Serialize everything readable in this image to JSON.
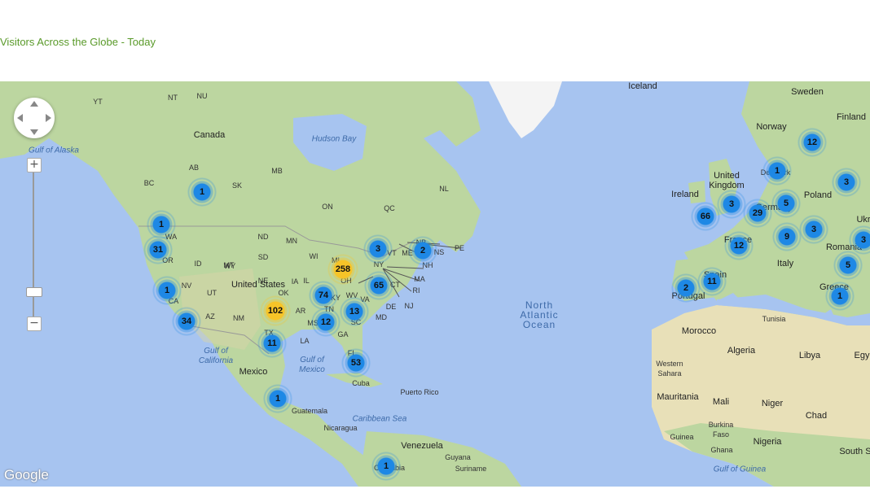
{
  "title": "Visitors Across the Globe - Today",
  "google_logo": "Google",
  "zoom": {
    "plus": "+",
    "minus": "−"
  },
  "colors": {
    "water": "#a7c4f0",
    "land": "#bcd6a0",
    "desert": "#e8e0b8",
    "ice": "#f4f4f4",
    "cluster_blue": "#1e88e5",
    "cluster_yellow": "#f6c428",
    "title": "#5a9a2a"
  },
  "labels": [
    {
      "text": "Iceland",
      "cls": "md"
    },
    {
      "text": "Sweden",
      "cls": "md"
    },
    {
      "text": "Finland",
      "cls": "md"
    },
    {
      "text": "Norway",
      "cls": "md"
    },
    {
      "text": "Canada",
      "cls": "md"
    },
    {
      "text": "Hudson Bay",
      "cls": "water"
    },
    {
      "text": "Gulf of Alaska",
      "cls": "water"
    },
    {
      "text": "YT",
      "cls": "sm"
    },
    {
      "text": "NT",
      "cls": "sm"
    },
    {
      "text": "NU",
      "cls": "sm"
    },
    {
      "text": "BC",
      "cls": "sm"
    },
    {
      "text": "AB",
      "cls": "sm"
    },
    {
      "text": "SK",
      "cls": "sm"
    },
    {
      "text": "MB",
      "cls": "sm"
    },
    {
      "text": "ON",
      "cls": "sm"
    },
    {
      "text": "QC",
      "cls": "sm"
    },
    {
      "text": "NL",
      "cls": "sm"
    },
    {
      "text": "WA",
      "cls": "sm"
    },
    {
      "text": "OR",
      "cls": "sm"
    },
    {
      "text": "ID",
      "cls": "sm"
    },
    {
      "text": "MT",
      "cls": "sm"
    },
    {
      "text": "ND",
      "cls": "sm"
    },
    {
      "text": "MN",
      "cls": "sm"
    },
    {
      "text": "WY",
      "cls": "sm"
    },
    {
      "text": "SD",
      "cls": "sm"
    },
    {
      "text": "NE",
      "cls": "sm"
    },
    {
      "text": "WI",
      "cls": "sm"
    },
    {
      "text": "IA",
      "cls": "sm"
    },
    {
      "text": "NV",
      "cls": "sm"
    },
    {
      "text": "UT",
      "cls": "sm"
    },
    {
      "text": "CA",
      "cls": "sm"
    },
    {
      "text": "AZ",
      "cls": "sm"
    },
    {
      "text": "NM",
      "cls": "sm"
    },
    {
      "text": "TX",
      "cls": "sm"
    },
    {
      "text": "OK",
      "cls": "sm"
    },
    {
      "text": "AR",
      "cls": "sm"
    },
    {
      "text": "MS",
      "cls": "sm"
    },
    {
      "text": "LA",
      "cls": "sm"
    },
    {
      "text": "TN",
      "cls": "sm"
    },
    {
      "text": "KY",
      "cls": "sm"
    },
    {
      "text": "WV",
      "cls": "sm"
    },
    {
      "text": "IL",
      "cls": "sm"
    },
    {
      "text": "MI",
      "cls": "sm"
    },
    {
      "text": "OH",
      "cls": "sm"
    },
    {
      "text": "GA",
      "cls": "sm"
    },
    {
      "text": "SC",
      "cls": "sm"
    },
    {
      "text": "FL",
      "cls": "sm"
    },
    {
      "text": "VA",
      "cls": "sm"
    },
    {
      "text": "NY",
      "cls": "sm"
    },
    {
      "text": "VT",
      "cls": "sm"
    },
    {
      "text": "ME",
      "cls": "sm"
    },
    {
      "text": "NB",
      "cls": "sm"
    },
    {
      "text": "NS",
      "cls": "sm"
    },
    {
      "text": "PE",
      "cls": "sm"
    },
    {
      "text": "NH",
      "cls": "sm"
    },
    {
      "text": "MA",
      "cls": "sm"
    },
    {
      "text": "CT",
      "cls": "sm"
    },
    {
      "text": "RI",
      "cls": "sm"
    },
    {
      "text": "NJ",
      "cls": "sm"
    },
    {
      "text": "DE",
      "cls": "sm"
    },
    {
      "text": "MD",
      "cls": "sm"
    },
    {
      "text": "United States",
      "cls": "lg"
    },
    {
      "text": "Mexico",
      "cls": "lg"
    },
    {
      "text": "Gulf of\nCalifornia",
      "cls": "water"
    },
    {
      "text": "Gulf of\nMexico",
      "cls": "water"
    },
    {
      "text": "Cuba",
      "cls": "sm"
    },
    {
      "text": "Puerto Rico",
      "cls": "sm"
    },
    {
      "text": "Guatemala",
      "cls": "sm"
    },
    {
      "text": "Nicaragua",
      "cls": "sm"
    },
    {
      "text": "Caribbean Sea",
      "cls": "water"
    },
    {
      "text": "Venezuela",
      "cls": "md"
    },
    {
      "text": "Guyana",
      "cls": "sm"
    },
    {
      "text": "Suriname",
      "cls": "sm"
    },
    {
      "text": "Colombia",
      "cls": "sm"
    },
    {
      "text": "North\nAtlantic\nOcean",
      "cls": "ocean"
    },
    {
      "text": "Ireland",
      "cls": "md"
    },
    {
      "text": "United\nKingdom",
      "cls": "md"
    },
    {
      "text": "Denmark",
      "cls": "sm"
    },
    {
      "text": "Germany",
      "cls": "md"
    },
    {
      "text": "Poland",
      "cls": "md"
    },
    {
      "text": "France",
      "cls": "md"
    },
    {
      "text": "Italy",
      "cls": "md"
    },
    {
      "text": "Romania",
      "cls": "md"
    },
    {
      "text": "Greece",
      "cls": "md"
    },
    {
      "text": "Spain",
      "cls": "md"
    },
    {
      "text": "Portugal",
      "cls": "md"
    },
    {
      "text": "Ukr",
      "cls": "md"
    },
    {
      "text": "Tunisia",
      "cls": "sm"
    },
    {
      "text": "Morocco",
      "cls": "md"
    },
    {
      "text": "Algeria",
      "cls": "md"
    },
    {
      "text": "Libya",
      "cls": "md"
    },
    {
      "text": "Egy",
      "cls": "md"
    },
    {
      "text": "Western\nSahara",
      "cls": "sm"
    },
    {
      "text": "Mauritania",
      "cls": "md"
    },
    {
      "text": "Mali",
      "cls": "md"
    },
    {
      "text": "Niger",
      "cls": "md"
    },
    {
      "text": "Chad",
      "cls": "md"
    },
    {
      "text": "Burkina\nFaso",
      "cls": "sm"
    },
    {
      "text": "Nigeria",
      "cls": "md"
    },
    {
      "text": "Guinea",
      "cls": "sm"
    },
    {
      "text": "Ghana",
      "cls": "sm"
    },
    {
      "text": "Gulf of Guinea",
      "cls": "water"
    },
    {
      "text": "South S",
      "cls": "md"
    }
  ],
  "clusters": [
    {
      "count": "1",
      "color": "blue"
    },
    {
      "count": "1",
      "color": "blue"
    },
    {
      "count": "31",
      "color": "blue"
    },
    {
      "count": "1",
      "color": "blue"
    },
    {
      "count": "34",
      "color": "blue"
    },
    {
      "count": "102",
      "color": "yellow"
    },
    {
      "count": "11",
      "color": "blue"
    },
    {
      "count": "1",
      "color": "blue"
    },
    {
      "count": "74",
      "color": "blue"
    },
    {
      "count": "12",
      "color": "blue"
    },
    {
      "count": "13",
      "color": "blue"
    },
    {
      "count": "53",
      "color": "blue"
    },
    {
      "count": "65",
      "color": "blue"
    },
    {
      "count": "258",
      "color": "yellow"
    },
    {
      "count": "3",
      "color": "blue"
    },
    {
      "count": "2",
      "color": "blue"
    },
    {
      "count": "1",
      "color": "blue"
    },
    {
      "count": "12",
      "color": "blue"
    },
    {
      "count": "1",
      "color": "blue"
    },
    {
      "count": "3",
      "color": "blue"
    },
    {
      "count": "5",
      "color": "blue"
    },
    {
      "count": "66",
      "color": "blue"
    },
    {
      "count": "29",
      "color": "blue"
    },
    {
      "count": "3",
      "color": "blue"
    },
    {
      "count": "9",
      "color": "blue"
    },
    {
      "count": "3",
      "color": "blue"
    },
    {
      "count": "12",
      "color": "blue"
    },
    {
      "count": "3",
      "color": "blue"
    },
    {
      "count": "5",
      "color": "blue"
    },
    {
      "count": "1",
      "color": "blue"
    },
    {
      "count": "2",
      "color": "blue"
    },
    {
      "count": "11",
      "color": "blue"
    }
  ]
}
